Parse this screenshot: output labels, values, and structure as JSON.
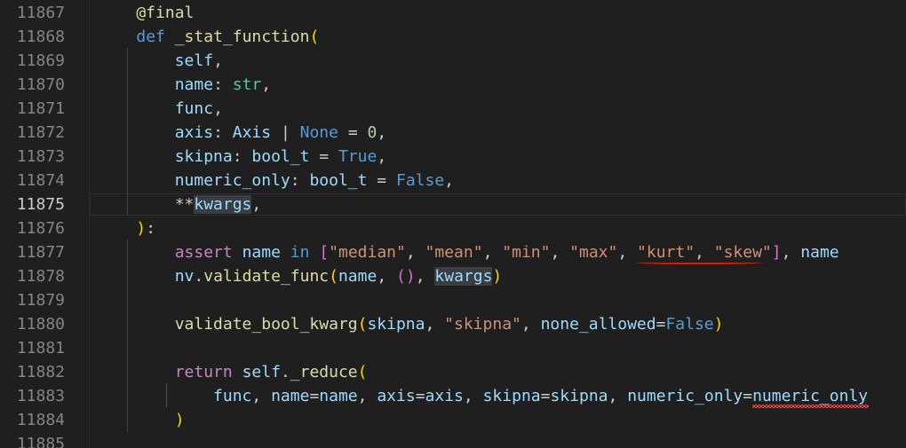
{
  "editor": {
    "line_numbers": [
      "11867",
      "11868",
      "11869",
      "11870",
      "11871",
      "11872",
      "11873",
      "11874",
      "11875",
      "11876",
      "11877",
      "11878",
      "11879",
      "11880",
      "11881",
      "11882",
      "11883",
      "11884",
      "11885"
    ],
    "active_line": "11875",
    "lines": [
      [
        {
          "t": "    @final",
          "c": "fn"
        }
      ],
      [
        {
          "t": "    ",
          "c": "txt"
        },
        {
          "t": "def",
          "c": "kw"
        },
        {
          "t": " ",
          "c": "txt"
        },
        {
          "t": "_stat_function",
          "c": "fn"
        },
        {
          "t": "(",
          "c": "br1"
        }
      ],
      [
        {
          "t": "        ",
          "c": "txt"
        },
        {
          "t": "self",
          "c": "var"
        },
        {
          "t": ",",
          "c": "txt"
        }
      ],
      [
        {
          "t": "        ",
          "c": "txt"
        },
        {
          "t": "name",
          "c": "var"
        },
        {
          "t": ": ",
          "c": "txt"
        },
        {
          "t": "str",
          "c": "type"
        },
        {
          "t": ",",
          "c": "txt"
        }
      ],
      [
        {
          "t": "        ",
          "c": "txt"
        },
        {
          "t": "func",
          "c": "var"
        },
        {
          "t": ",",
          "c": "txt"
        }
      ],
      [
        {
          "t": "        ",
          "c": "txt"
        },
        {
          "t": "axis",
          "c": "var"
        },
        {
          "t": ": ",
          "c": "txt"
        },
        {
          "t": "Axis",
          "c": "var"
        },
        {
          "t": " | ",
          "c": "txt"
        },
        {
          "t": "None",
          "c": "kw"
        },
        {
          "t": " = ",
          "c": "txt"
        },
        {
          "t": "0",
          "c": "num"
        },
        {
          "t": ",",
          "c": "txt"
        }
      ],
      [
        {
          "t": "        ",
          "c": "txt"
        },
        {
          "t": "skipna",
          "c": "var"
        },
        {
          "t": ": ",
          "c": "txt"
        },
        {
          "t": "bool_t",
          "c": "var"
        },
        {
          "t": " = ",
          "c": "txt"
        },
        {
          "t": "True",
          "c": "kw"
        },
        {
          "t": ",",
          "c": "txt"
        }
      ],
      [
        {
          "t": "        ",
          "c": "txt"
        },
        {
          "t": "numeric_only",
          "c": "var"
        },
        {
          "t": ": ",
          "c": "txt"
        },
        {
          "t": "bool_t",
          "c": "var"
        },
        {
          "t": " = ",
          "c": "txt"
        },
        {
          "t": "False",
          "c": "kw"
        },
        {
          "t": ",",
          "c": "txt"
        }
      ],
      [
        {
          "t": "        **",
          "c": "txt"
        },
        {
          "t": "kwargs",
          "c": "var hl"
        },
        {
          "t": ",",
          "c": "txt"
        }
      ],
      [
        {
          "t": "    ",
          "c": "txt"
        },
        {
          "t": ")",
          "c": "br1"
        },
        {
          "t": ":",
          "c": "txt"
        }
      ],
      [
        {
          "t": "        ",
          "c": "txt"
        },
        {
          "t": "assert",
          "c": "kw2"
        },
        {
          "t": " ",
          "c": "txt"
        },
        {
          "t": "name",
          "c": "var"
        },
        {
          "t": " ",
          "c": "txt"
        },
        {
          "t": "in",
          "c": "kw"
        },
        {
          "t": " ",
          "c": "txt"
        },
        {
          "t": "[",
          "c": "br2"
        },
        {
          "t": "\"median\"",
          "c": "str"
        },
        {
          "t": ", ",
          "c": "txt"
        },
        {
          "t": "\"mean\"",
          "c": "str"
        },
        {
          "t": ", ",
          "c": "txt"
        },
        {
          "t": "\"min\"",
          "c": "str"
        },
        {
          "t": ", ",
          "c": "txt"
        },
        {
          "t": "\"max\"",
          "c": "str"
        },
        {
          "t": ", ",
          "c": "txt"
        },
        {
          "t": "\"kurt\"",
          "c": "str"
        },
        {
          "t": ", ",
          "c": "txt"
        },
        {
          "t": "\"skew\"",
          "c": "str"
        },
        {
          "t": "]",
          "c": "br2"
        },
        {
          "t": ", ",
          "c": "txt"
        },
        {
          "t": "name",
          "c": "var"
        }
      ],
      [
        {
          "t": "        ",
          "c": "txt"
        },
        {
          "t": "nv",
          "c": "var"
        },
        {
          "t": ".",
          "c": "txt"
        },
        {
          "t": "validate_func",
          "c": "fn"
        },
        {
          "t": "(",
          "c": "br1"
        },
        {
          "t": "name",
          "c": "var"
        },
        {
          "t": ", ",
          "c": "txt"
        },
        {
          "t": "()",
          "c": "br2"
        },
        {
          "t": ", ",
          "c": "txt"
        },
        {
          "t": "kwargs",
          "c": "var hl"
        },
        {
          "t": ")",
          "c": "br1"
        }
      ],
      [],
      [
        {
          "t": "        ",
          "c": "txt"
        },
        {
          "t": "validate_bool_kwarg",
          "c": "fn"
        },
        {
          "t": "(",
          "c": "br1"
        },
        {
          "t": "skipna",
          "c": "var"
        },
        {
          "t": ", ",
          "c": "txt"
        },
        {
          "t": "\"skipna\"",
          "c": "str"
        },
        {
          "t": ", ",
          "c": "txt"
        },
        {
          "t": "none_allowed",
          "c": "var"
        },
        {
          "t": "=",
          "c": "txt"
        },
        {
          "t": "False",
          "c": "kw"
        },
        {
          "t": ")",
          "c": "br1"
        }
      ],
      [],
      [
        {
          "t": "        ",
          "c": "txt"
        },
        {
          "t": "return",
          "c": "kw2"
        },
        {
          "t": " ",
          "c": "txt"
        },
        {
          "t": "self",
          "c": "var"
        },
        {
          "t": ".",
          "c": "txt"
        },
        {
          "t": "_reduce",
          "c": "fn"
        },
        {
          "t": "(",
          "c": "br1"
        }
      ],
      [
        {
          "t": "            ",
          "c": "txt"
        },
        {
          "t": "func",
          "c": "var"
        },
        {
          "t": ", ",
          "c": "txt"
        },
        {
          "t": "name",
          "c": "var"
        },
        {
          "t": "=",
          "c": "txt"
        },
        {
          "t": "name",
          "c": "var"
        },
        {
          "t": ", ",
          "c": "txt"
        },
        {
          "t": "axis",
          "c": "var"
        },
        {
          "t": "=",
          "c": "txt"
        },
        {
          "t": "axis",
          "c": "var"
        },
        {
          "t": ", ",
          "c": "txt"
        },
        {
          "t": "skipna",
          "c": "var"
        },
        {
          "t": "=",
          "c": "txt"
        },
        {
          "t": "skipna",
          "c": "var"
        },
        {
          "t": ", ",
          "c": "txt"
        },
        {
          "t": "numeric_only",
          "c": "var"
        },
        {
          "t": "=",
          "c": "txt"
        },
        {
          "t": "numeric_only",
          "c": "var"
        }
      ],
      [
        {
          "t": "        ",
          "c": "txt"
        },
        {
          "t": ")",
          "c": "br1"
        }
      ],
      []
    ]
  },
  "colors": {
    "background": "#1f1f1f",
    "error_underline": "#e51400",
    "squiggle": "#f14c4c"
  }
}
